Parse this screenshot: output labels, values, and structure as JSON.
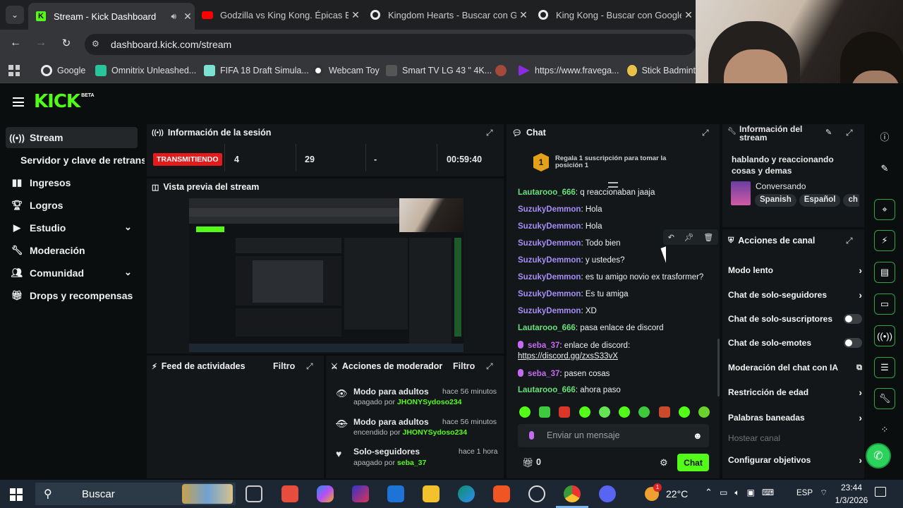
{
  "browser": {
    "tabs": [
      {
        "title": "Stream - Kick Dashboard",
        "active": true
      },
      {
        "title": "Godzilla vs King Kong. Épicas B",
        "active": false
      },
      {
        "title": "Kingdom Hearts - Buscar con G",
        "active": false
      },
      {
        "title": "King Kong - Buscar con Google",
        "active": false
      }
    ],
    "url": "dashboard.kick.com/stream",
    "bookmarks": [
      "Google",
      "Omnitrix Unleashed...",
      "FIFA 18 Draft Simula...",
      "Webcam Toy",
      "Smart TV LG 43 \" 4K...",
      "https://www.fravega...",
      "Stick Badmint"
    ]
  },
  "kick": {
    "logo": "KICK",
    "beta": "BETA",
    "accent": "#53fc18"
  },
  "sidebar": {
    "items": [
      {
        "label": "Stream",
        "icon": "broadcast-icon",
        "active": true
      },
      {
        "label": "Servidor y clave de retransm",
        "icon": ""
      },
      {
        "label": "Ingresos",
        "icon": "chart-icon"
      },
      {
        "label": "Logros",
        "icon": "trophy-icon"
      },
      {
        "label": "Estudio",
        "icon": "video-icon",
        "chevron": true
      },
      {
        "label": "Moderación",
        "icon": "wrench-icon"
      },
      {
        "label": "Comunidad",
        "icon": "users-icon",
        "chevron": true
      },
      {
        "label": "Drops y recompensas",
        "icon": "gift-icon"
      }
    ]
  },
  "session": {
    "title": "Información de la sesión",
    "status": "TRANSMITIENDO",
    "viewers": "4",
    "followers": "29",
    "subs": "-",
    "duration": "00:59:40"
  },
  "preview": {
    "title": "Vista previa del stream"
  },
  "activity": {
    "title": "Feed de actividades",
    "filter": "Filtro"
  },
  "modactions": {
    "title": "Acciones de moderador",
    "filter": "Filtro",
    "items": [
      {
        "action": "Modo para adultos",
        "time": "hace 56 minutos",
        "state": "apagado por",
        "user": "JHONYSydoso234",
        "icon": "eye-icon"
      },
      {
        "action": "Modo para adultos",
        "time": "hace 56 minutos",
        "state": "encendido por",
        "user": "JHONYSydoso234",
        "icon": "eye-off-icon"
      },
      {
        "action": "Solo-seguidores",
        "time": "hace 1 hora",
        "state": "apagado por",
        "user": "seba_37",
        "icon": "heart-icon"
      }
    ]
  },
  "chat": {
    "title": "Chat",
    "gift_rank": "1",
    "gift_text": "Regala 1 suscripción para tomar la posición 1",
    "messages": [
      {
        "user": "Lautarooo_666",
        "text": "q reaccionaban jaaja",
        "color": "u1"
      },
      {
        "user": "SuzukyDemmon",
        "text": "Hola",
        "color": "u2"
      },
      {
        "user": "SuzukyDemmon",
        "text": "Hola",
        "color": "u2"
      },
      {
        "user": "SuzukyDemmon",
        "text": "Todo bien",
        "color": "u2"
      },
      {
        "user": "SuzukyDemmon",
        "text": "y ustedes?",
        "color": "u2"
      },
      {
        "user": "SuzukyDemmon",
        "text": "es tu amigo novio ex trasformer?",
        "color": "u2"
      },
      {
        "user": "SuzukyDemmon",
        "text": "Es tu amiga",
        "color": "u2"
      },
      {
        "user": "SuzukyDemmon",
        "text": "XD",
        "color": "u2"
      },
      {
        "user": "Lautarooo_666",
        "text": "pasa enlace de discord",
        "color": "u1"
      },
      {
        "user": "seba_37",
        "text": "enlace de discord:",
        "color": "u3"
      },
      {
        "user": "",
        "text": "https://discord.gg/zxsS33vX",
        "color": "link"
      },
      {
        "user": "seba_37",
        "text": "pasen cosas",
        "color": "u3"
      },
      {
        "user": "Lautarooo_666",
        "text": "ahora paso",
        "color": "u1"
      }
    ],
    "placeholder": "Enviar un mensaje",
    "points": "0",
    "send_label": "Chat"
  },
  "streaminfo": {
    "title": "Información del stream",
    "stream_title": "hablando y reaccionando cosas y demas",
    "category": "Conversando",
    "tags": [
      "Spanish",
      "Español",
      "ch"
    ]
  },
  "channel_actions": {
    "title": "Acciones de canal",
    "items": [
      {
        "label": "Modo lento",
        "control": "chevron"
      },
      {
        "label": "Chat de solo-seguidores",
        "control": "chevron"
      },
      {
        "label": "Chat de solo-suscriptores",
        "control": "toggle"
      },
      {
        "label": "Chat de solo-emotes",
        "control": "toggle"
      },
      {
        "label": "Moderación del chat con IA",
        "control": "external"
      },
      {
        "label": "Restricción de edad",
        "control": "chevron"
      },
      {
        "label": "Palabras baneadas",
        "control": "chevron"
      },
      {
        "label": "Hostear canal",
        "control": "disabled"
      },
      {
        "label": "Configurar objetivos",
        "control": "chevron"
      }
    ]
  },
  "taskbar": {
    "search": "Buscar",
    "temp": "22°C",
    "lang": "ESP",
    "time": "23:44",
    "date": "1/3/2026",
    "weather_badge": "1"
  }
}
